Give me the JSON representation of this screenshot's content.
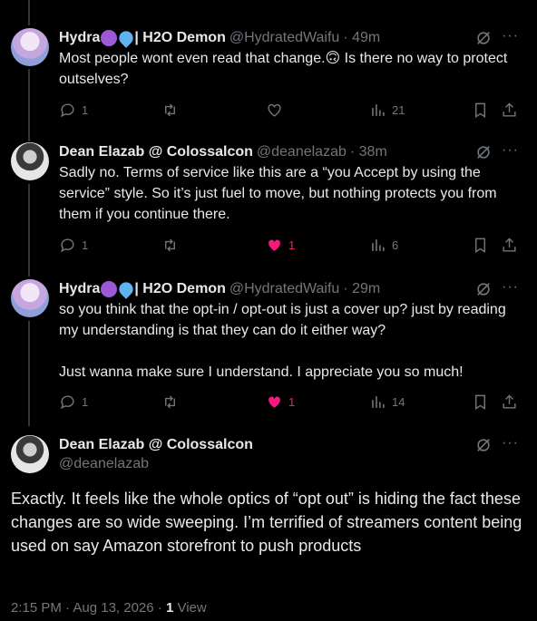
{
  "tweets": [
    {
      "name": "Hydra",
      "name_suffix": " | H2O Demon",
      "handle": "@HydratedWaifu",
      "time": "· 49m",
      "text": "Most people wont even read that change.🙃 Is there no way to protect outselves?",
      "replies": "1",
      "likes": "",
      "views": "21"
    },
    {
      "name": "Dean Elazab @ Colossalcon",
      "handle": "@deanelazab",
      "time": "· 38m",
      "text": "Sadly no. Terms of service like this are a “you Accept by using the service” style. So it’s just fuel to move, but nothing protects you from them if you continue there.",
      "replies": "1",
      "likes": "1",
      "views": "6"
    },
    {
      "name": "Hydra",
      "name_suffix": " | H2O Demon",
      "handle": "@HydratedWaifu",
      "time": "· 29m",
      "text_p1": "so you think that the opt-in / opt-out is just a cover up? just by reading my understanding is that they can do it either way?",
      "text_p2": "Just wanna make sure I understand. I appreciate you so much!",
      "replies": "1",
      "likes": "1",
      "views": "14"
    }
  ],
  "main_tweet": {
    "name": "Dean Elazab @ Colossalcon",
    "handle": "@deanelazab",
    "text": "Exactly. It feels like the whole optics of “opt out” is hiding the fact these changes are so wide sweeping. I’m terrified of streamers content being used on say Amazon storefront to push products",
    "timestamp": "2:15 PM · Aug 13, 2026 · ",
    "view_count": "1",
    "view_label": " View"
  },
  "colors": {
    "like": "#f91880",
    "muted": "#71767b",
    "text": "#e7e9ea"
  }
}
